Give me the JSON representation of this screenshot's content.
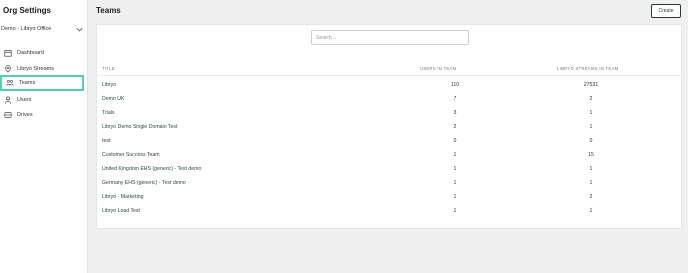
{
  "sidebar": {
    "title": "Org Settings",
    "org_select": "Demo - Libryo Office",
    "items": [
      {
        "label": "Dashboard",
        "icon": "calendar-icon"
      },
      {
        "label": "Libryo Streams",
        "icon": "map-pin-icon"
      },
      {
        "label": "Teams",
        "icon": "team-icon",
        "active": true
      },
      {
        "label": "Users",
        "icon": "user-icon"
      },
      {
        "label": "Drives",
        "icon": "drive-icon"
      }
    ]
  },
  "header": {
    "title": "Teams",
    "create_label": "Create"
  },
  "search": {
    "placeholder": "Search..."
  },
  "table": {
    "columns": [
      "TITLE",
      "USERS IN TEAM",
      "LIBRYO STREAMS IN TEAM"
    ],
    "rows": [
      {
        "title": "Libryo",
        "users": "110",
        "streams": "27531"
      },
      {
        "title": "Demo UK",
        "users": "7",
        "streams": "2"
      },
      {
        "title": "Trials",
        "users": "3",
        "streams": "1"
      },
      {
        "title": "Libryo Demo Single Domain Test",
        "users": "2",
        "streams": "1"
      },
      {
        "title": "test",
        "users": "0",
        "streams": "0"
      },
      {
        "title": "Customer Success Team",
        "users": "1",
        "streams": "15"
      },
      {
        "title": "United Kingdom EHS (generic) - Test demo",
        "users": "1",
        "streams": "1"
      },
      {
        "title": "Germany EHS (generic) - Test demo",
        "users": "1",
        "streams": "1"
      },
      {
        "title": "Libryo - Marketing",
        "users": "1",
        "streams": "2"
      },
      {
        "title": "Libryo Load Test",
        "users": "1",
        "streams": "1"
      }
    ]
  },
  "colors": {
    "accent": "#4fd1b8",
    "link": "#2c4a3c",
    "button_border": "#1f3d33"
  }
}
